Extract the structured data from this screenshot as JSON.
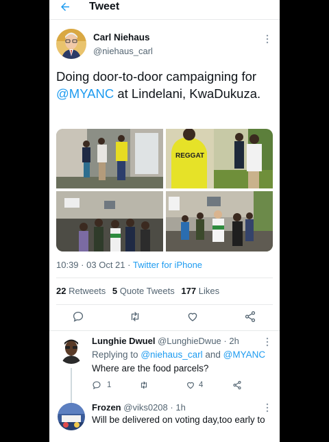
{
  "header": {
    "title": "Tweet"
  },
  "tweet": {
    "author_name": "Carl Niehaus",
    "author_handle": "@niehaus_carl",
    "text_before": "Doing door-to-door campaigning for ",
    "mention": "@MYANC",
    "text_after": " at Lindelani, KwaDukuza.",
    "time": "10:39",
    "date": "03 Oct 21",
    "separator": "·",
    "source": "Twitter for iPhone",
    "retweets_count": "22",
    "retweets_label": "Retweets",
    "quote_count": "5",
    "quote_label": "Quote Tweets",
    "likes_count": "177",
    "likes_label": "Likes",
    "photo_sign_text": "REGGAT"
  },
  "replies": [
    {
      "name": "Lunghie Dwuel",
      "handle": "@LunghieDwue",
      "time": "2h",
      "replying_label": "Replying to",
      "replying_user1": "@niehaus_carl",
      "replying_and": "and",
      "replying_user2": "@MYANC",
      "text": "Where are the food parcels?",
      "reply_count": "1",
      "like_count": "4"
    },
    {
      "name": "Frozen",
      "handle": "@viks0208",
      "time": "1h",
      "text": "Will be delivered on voting day,too early to"
    }
  ],
  "colors": {
    "accent": "#1d9bf0",
    "text": "#0f1419",
    "secondary": "#536471",
    "divider": "#e7e9ea"
  }
}
